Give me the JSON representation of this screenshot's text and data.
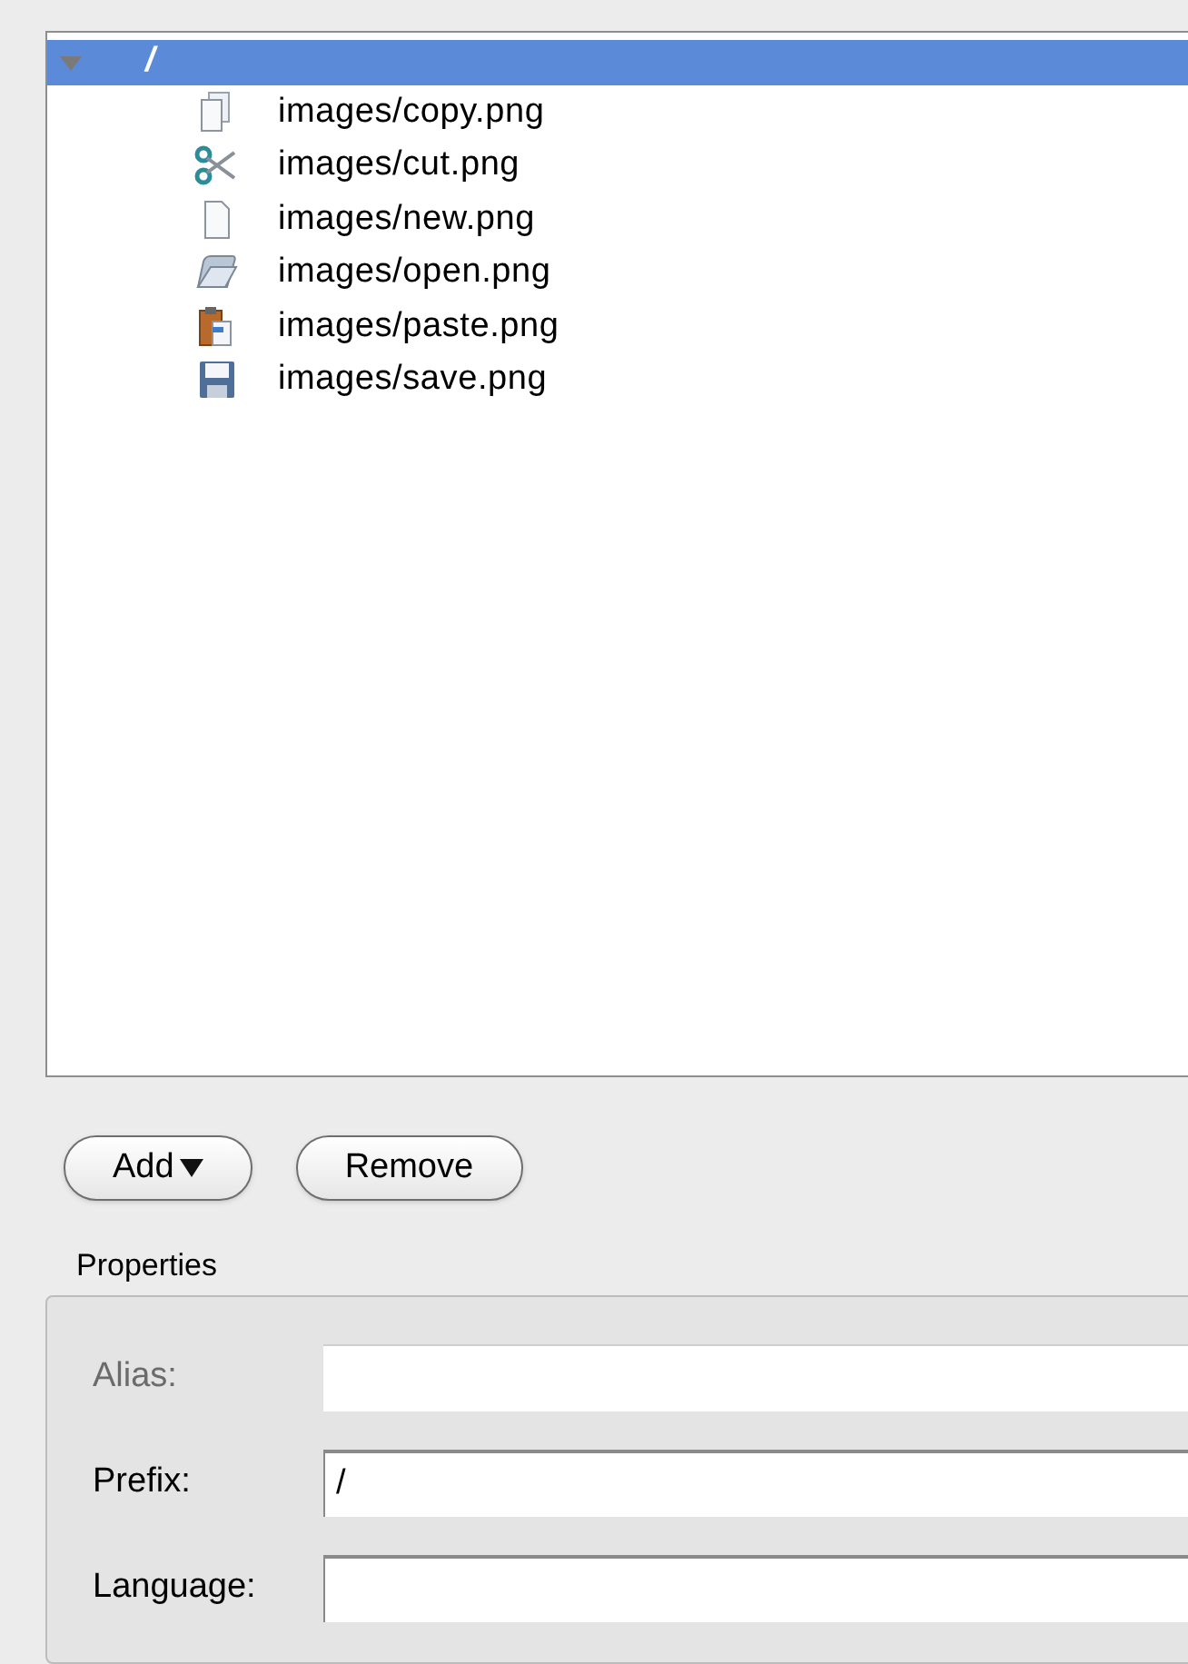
{
  "tree": {
    "label": "/",
    "expanded": true,
    "selected": true,
    "children": [
      {
        "label": "images/copy.png",
        "kind": "copy",
        "selected": false
      },
      {
        "label": "images/cut.png",
        "kind": "cut",
        "selected": false
      },
      {
        "label": "images/new.png",
        "kind": "new",
        "selected": false
      },
      {
        "label": "images/open.png",
        "kind": "open",
        "selected": false
      },
      {
        "label": "images/paste.png",
        "kind": "paste",
        "selected": false
      },
      {
        "label": "images/save.png",
        "kind": "save",
        "selected": false
      }
    ]
  },
  "buttons": [
    {
      "label": "Add",
      "dropdown": true
    },
    {
      "label": "Remove",
      "dropdown": false
    }
  ],
  "properties": {
    "title": "Properties",
    "fields": [
      {
        "label": "Alias:",
        "disabled": true
      },
      {
        "label": "Prefix:",
        "value": "/",
        "disabled": false
      },
      {
        "label": "Language:",
        "disabled": false
      }
    ]
  }
}
